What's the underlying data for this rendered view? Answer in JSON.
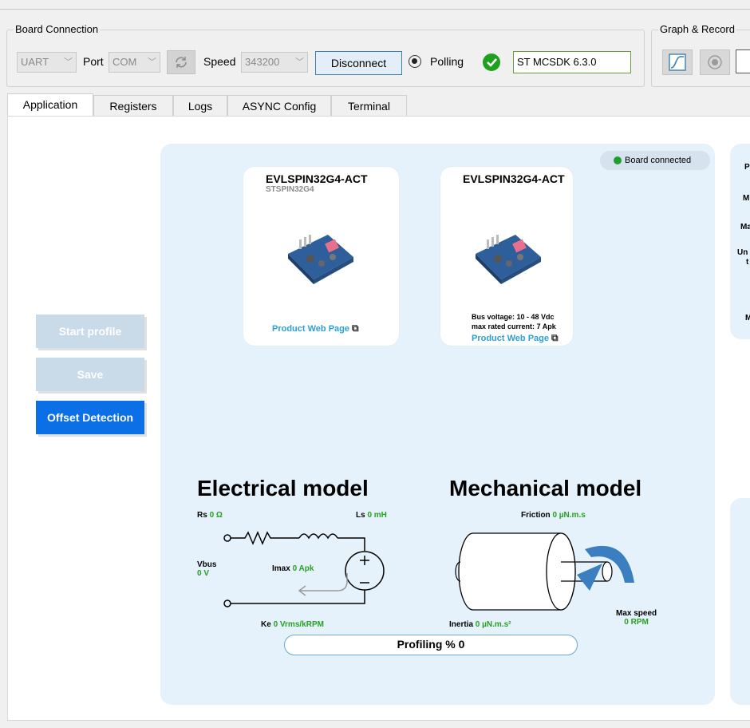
{
  "connection": {
    "legend": "Board Connection",
    "interface": "UART",
    "port_label": "Port",
    "port_value": "COM",
    "speed_label": "Speed",
    "speed_value": "343200",
    "disconnect_label": "Disconnect",
    "polling_label": "Polling",
    "firmware": "ST MCSDK 6.3.0"
  },
  "graph": {
    "legend": "Graph & Record"
  },
  "tabs": [
    {
      "label": "Application"
    },
    {
      "label": "Registers"
    },
    {
      "label": "Logs"
    },
    {
      "label": "ASYNC Config"
    },
    {
      "label": "Terminal"
    }
  ],
  "sidebar": {
    "start_profile": "Start profile",
    "save": "Save",
    "offset_detection": "Offset Detection"
  },
  "status": {
    "board_connected": "Board connected"
  },
  "boards": [
    {
      "name": "EVLSPIN32G4-ACT",
      "sub": "STSPIN32G4",
      "link": "Product Web Page"
    },
    {
      "name": "EVLSPIN32G4-ACT",
      "spec1": "Bus voltage: 10 - 48 Vdc",
      "spec2": "max rated current: 7 Apk",
      "link": "Product Web Page"
    }
  ],
  "right_labels": [
    "P",
    "M",
    "Ma",
    "Un",
    "t",
    "M"
  ],
  "electrical": {
    "title": "Electrical model",
    "rs_label": "Rs",
    "rs_value": "0 Ω",
    "ls_label": "Ls",
    "ls_value": "0 mH",
    "vbus_label": "Vbus",
    "vbus_value": "0 V",
    "imax_label": "Imax",
    "imax_value": "0 Apk",
    "ke_label": "Ke",
    "ke_value": "0 Vrms/kRPM"
  },
  "mechanical": {
    "title": "Mechanical model",
    "friction_label": "Friction",
    "friction_value": "0 µN.m.s",
    "inertia_label": "Inertia",
    "inertia_value": "0 µN.m.s²",
    "maxspeed_label": "Max speed",
    "maxspeed_value": "0 RPM"
  },
  "profiling": {
    "label": "Profiling % 0",
    "progress": 0
  },
  "colors": {
    "accent": "#0b6fe6",
    "disabled": "#c9dbe9",
    "panel": "#e6f2fb",
    "green": "#27a022"
  }
}
